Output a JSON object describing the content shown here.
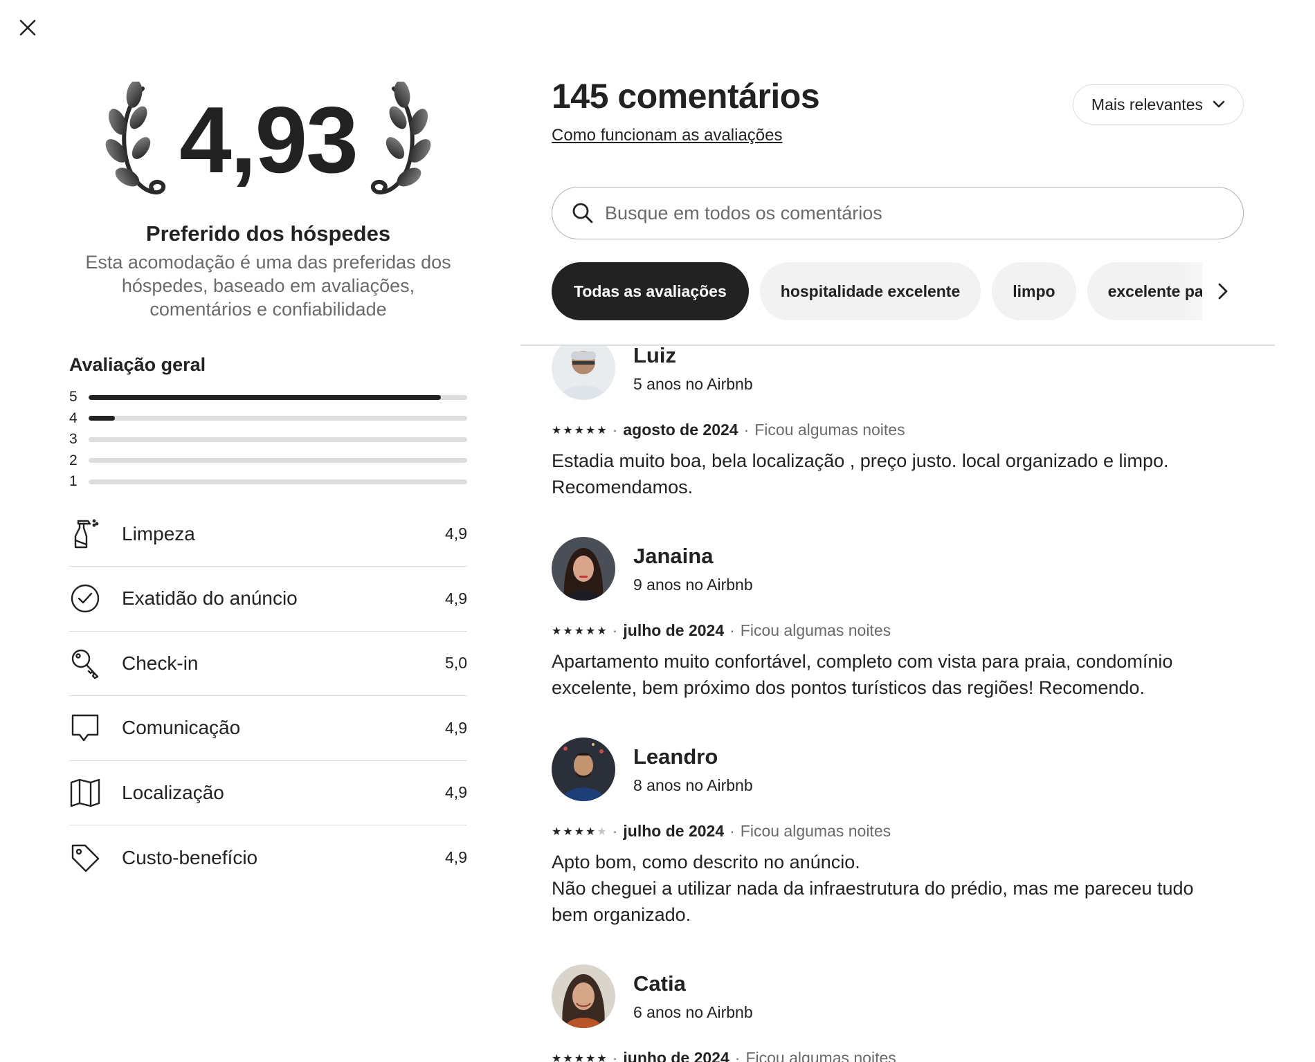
{
  "close": {
    "icon": "close-icon"
  },
  "hero": {
    "rating": "4,93",
    "title": "Preferido dos hóspedes",
    "description": "Esta acomodação é uma das preferidas dos hóspedes, baseado em avaliações, comentários e confiabilidade"
  },
  "overall": {
    "title": "Avaliação geral",
    "distribution": [
      {
        "stars": "5",
        "fraction": 0.93
      },
      {
        "stars": "4",
        "fraction": 0.07
      },
      {
        "stars": "3",
        "fraction": 0.0
      },
      {
        "stars": "2",
        "fraction": 0.0
      },
      {
        "stars": "1",
        "fraction": 0.0
      }
    ]
  },
  "categories": [
    {
      "label": "Limpeza",
      "value": "4,9",
      "icon": "spray-bottle-icon"
    },
    {
      "label": "Exatidão do anúncio",
      "value": "4,9",
      "icon": "check-circle-icon"
    },
    {
      "label": "Check-in",
      "value": "5,0",
      "icon": "key-icon"
    },
    {
      "label": "Comunicação",
      "value": "4,9",
      "icon": "chat-bubble-icon"
    },
    {
      "label": "Localização",
      "value": "4,9",
      "icon": "map-icon"
    },
    {
      "label": "Custo-benefício",
      "value": "4,9",
      "icon": "tag-icon"
    }
  ],
  "reviews_header": {
    "count_title": "145 comentários",
    "how_link": "Como funcionam as avaliações",
    "sort_label": "Mais relevantes"
  },
  "search": {
    "placeholder": "Busque em todos os comentários"
  },
  "chips": [
    {
      "label": "Todas as avaliações",
      "active": true
    },
    {
      "label": "hospitalidade excelente",
      "active": false
    },
    {
      "label": "limpo",
      "active": false
    },
    {
      "label": "excelente para",
      "active": false
    }
  ],
  "reviews": [
    {
      "name": "Luiz",
      "tenure": "5 anos no Airbnb",
      "stars": 5,
      "date": "agosto de 2024",
      "stay": "Ficou algumas noites",
      "text": "Estadia muito boa, bela localização , preço justo. local organizado e limpo.\nRecomendamos.",
      "avatar_color": "#8a8f96"
    },
    {
      "name": "Janaina",
      "tenure": "9 anos no Airbnb",
      "stars": 5,
      "date": "julho de 2024",
      "stay": "Ficou algumas noites",
      "text": "Apartamento muito confortável, completo com vista para praia,  condomínio\nexcelente, bem próximo dos pontos turísticos das regiões! Recomendo.",
      "avatar_color": "#5a3b33"
    },
    {
      "name": "Leandro",
      "tenure": "8 anos no Airbnb",
      "stars": 4,
      "date": "julho de 2024",
      "stay": "Ficou algumas noites",
      "text": "Apto bom, como descrito no anúncio.\nNão cheguei a utilizar nada da infraestrutura do prédio, mas me pareceu tudo\nbem organizado.",
      "avatar_color": "#2d3d5c"
    },
    {
      "name": "Catia",
      "tenure": "6 anos no Airbnb",
      "stars": 5,
      "date": "junho de 2024",
      "stay": "Ficou algumas noites",
      "text": "",
      "avatar_color": "#7a5a45"
    }
  ]
}
